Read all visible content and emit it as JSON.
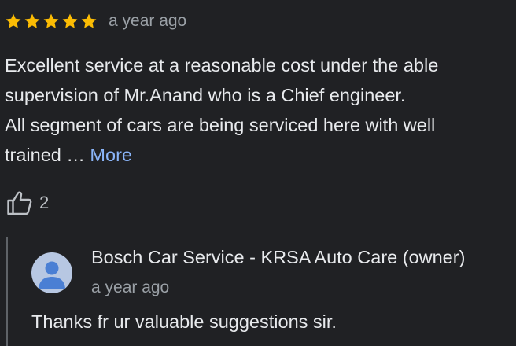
{
  "review": {
    "rating": 5,
    "max_rating": 5,
    "time": "a year ago",
    "text_lines": [
      "Excellent service at a reasonable cost under the able",
      "supervision of Mr.Anand who is a Chief engineer.",
      "All segment of cars are being serviced here with well",
      "trained … "
    ],
    "more_label": "More",
    "like_count": "2",
    "star_color": "#fbbc04",
    "like_icon": "thumbs-up-icon"
  },
  "owner_response": {
    "name": "Bosch Car Service - KRSA Auto Care (owner)",
    "time": "a year ago",
    "text": "Thanks fr ur valuable suggestions sir.",
    "avatar_icon": "person-avatar-icon",
    "avatar_color": "#4a7fd4"
  }
}
